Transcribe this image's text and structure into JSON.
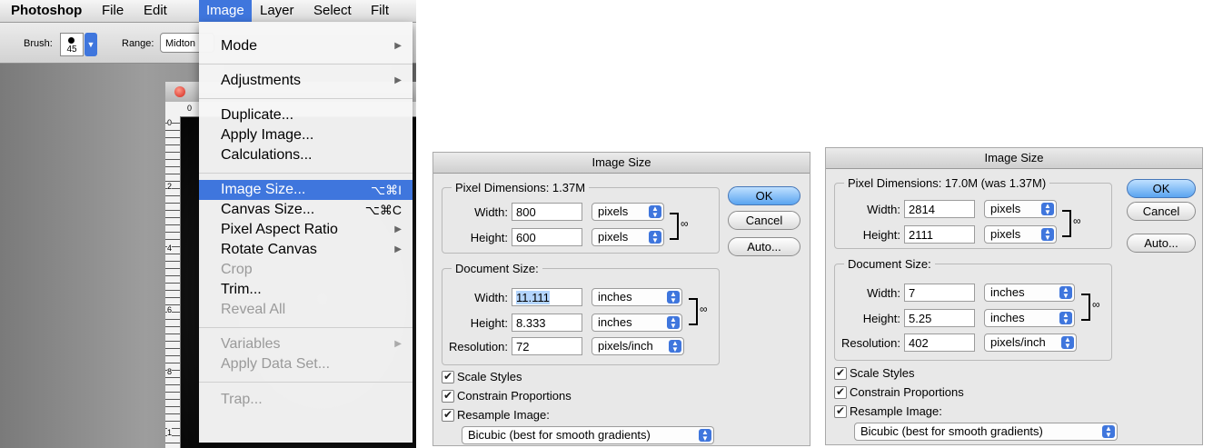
{
  "photoshop": {
    "menubar": {
      "app": "Photoshop",
      "file": "File",
      "edit": "Edit",
      "image": "Image",
      "layer": "Layer",
      "select": "Select",
      "filter": "Filt"
    },
    "options": {
      "brush_label": "Brush:",
      "brush_size": "45",
      "range_label": "Range:",
      "range_value": "Midton"
    },
    "rulers": {
      "top": [
        "0"
      ],
      "left": [
        "0",
        "2",
        "4",
        "6",
        "8",
        "1"
      ]
    },
    "image_menu": {
      "mode": "Mode",
      "adjustments": "Adjustments",
      "duplicate": "Duplicate...",
      "apply_image": "Apply Image...",
      "calculations": "Calculations...",
      "image_size": "Image Size...",
      "image_size_shortcut": "⌥⌘I",
      "canvas_size": "Canvas Size...",
      "canvas_size_shortcut": "⌥⌘C",
      "pixel_aspect_ratio": "Pixel Aspect Ratio",
      "rotate_canvas": "Rotate Canvas",
      "crop": "Crop",
      "trim": "Trim...",
      "reveal_all": "Reveal All",
      "variables": "Variables",
      "apply_data_set": "Apply Data Set...",
      "trap": "Trap..."
    }
  },
  "dialogs": [
    {
      "title": "Image Size",
      "pixel_dimensions_title": "Pixel Dimensions:  1.37M",
      "width_label": "Width:",
      "height_label": "Height:",
      "resolution_label": "Resolution:",
      "px_width": "800",
      "px_width_unit": "pixels",
      "px_height": "600",
      "px_height_unit": "pixels",
      "document_size_title": "Document Size:",
      "doc_width": "11.111",
      "doc_width_unit": "inches",
      "doc_height": "8.333",
      "doc_height_unit": "inches",
      "resolution": "72",
      "resolution_unit": "pixels/inch",
      "ok": "OK",
      "cancel": "Cancel",
      "auto": "Auto...",
      "scale_styles": "Scale Styles",
      "constrain_proportions": "Constrain Proportions",
      "resample_image": "Resample Image:",
      "resample_method": "Bicubic (best for smooth gradients)"
    },
    {
      "title": "Image Size",
      "pixel_dimensions_title": "Pixel Dimensions:  17.0M (was 1.37M)",
      "width_label": "Width:",
      "height_label": "Height:",
      "resolution_label": "Resolution:",
      "px_width": "2814",
      "px_width_unit": "pixels",
      "px_height": "2111",
      "px_height_unit": "pixels",
      "document_size_title": "Document Size:",
      "doc_width": "7",
      "doc_width_unit": "inches",
      "doc_height": "5.25",
      "doc_height_unit": "inches",
      "resolution": "402",
      "resolution_unit": "pixels/inch",
      "ok": "OK",
      "cancel": "Cancel",
      "auto": "Auto...",
      "scale_styles": "Scale Styles",
      "constrain_proportions": "Constrain Proportions",
      "resample_image": "Resample Image:",
      "resample_method": "Bicubic (best for smooth gradients)"
    }
  ]
}
